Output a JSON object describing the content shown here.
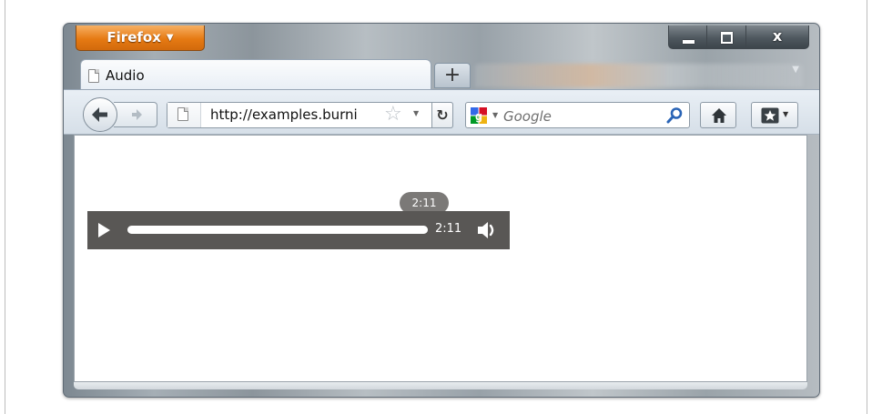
{
  "window": {
    "app_button_label": "Firefox",
    "controls": {
      "minimize": "minimize",
      "maximize": "maximize",
      "close": "x"
    }
  },
  "tabs": {
    "active_tab_title": "Audio",
    "new_tab_label": "+"
  },
  "navbar": {
    "url": "http://examples.burni",
    "search_placeholder": "Google"
  },
  "player": {
    "current_time": "2:11",
    "tooltip_time": "2:11",
    "progress_fraction": 1.0
  },
  "colors": {
    "firefox_orange": "#e67a13",
    "player_bg": "#595755",
    "track": "#ffffff"
  }
}
